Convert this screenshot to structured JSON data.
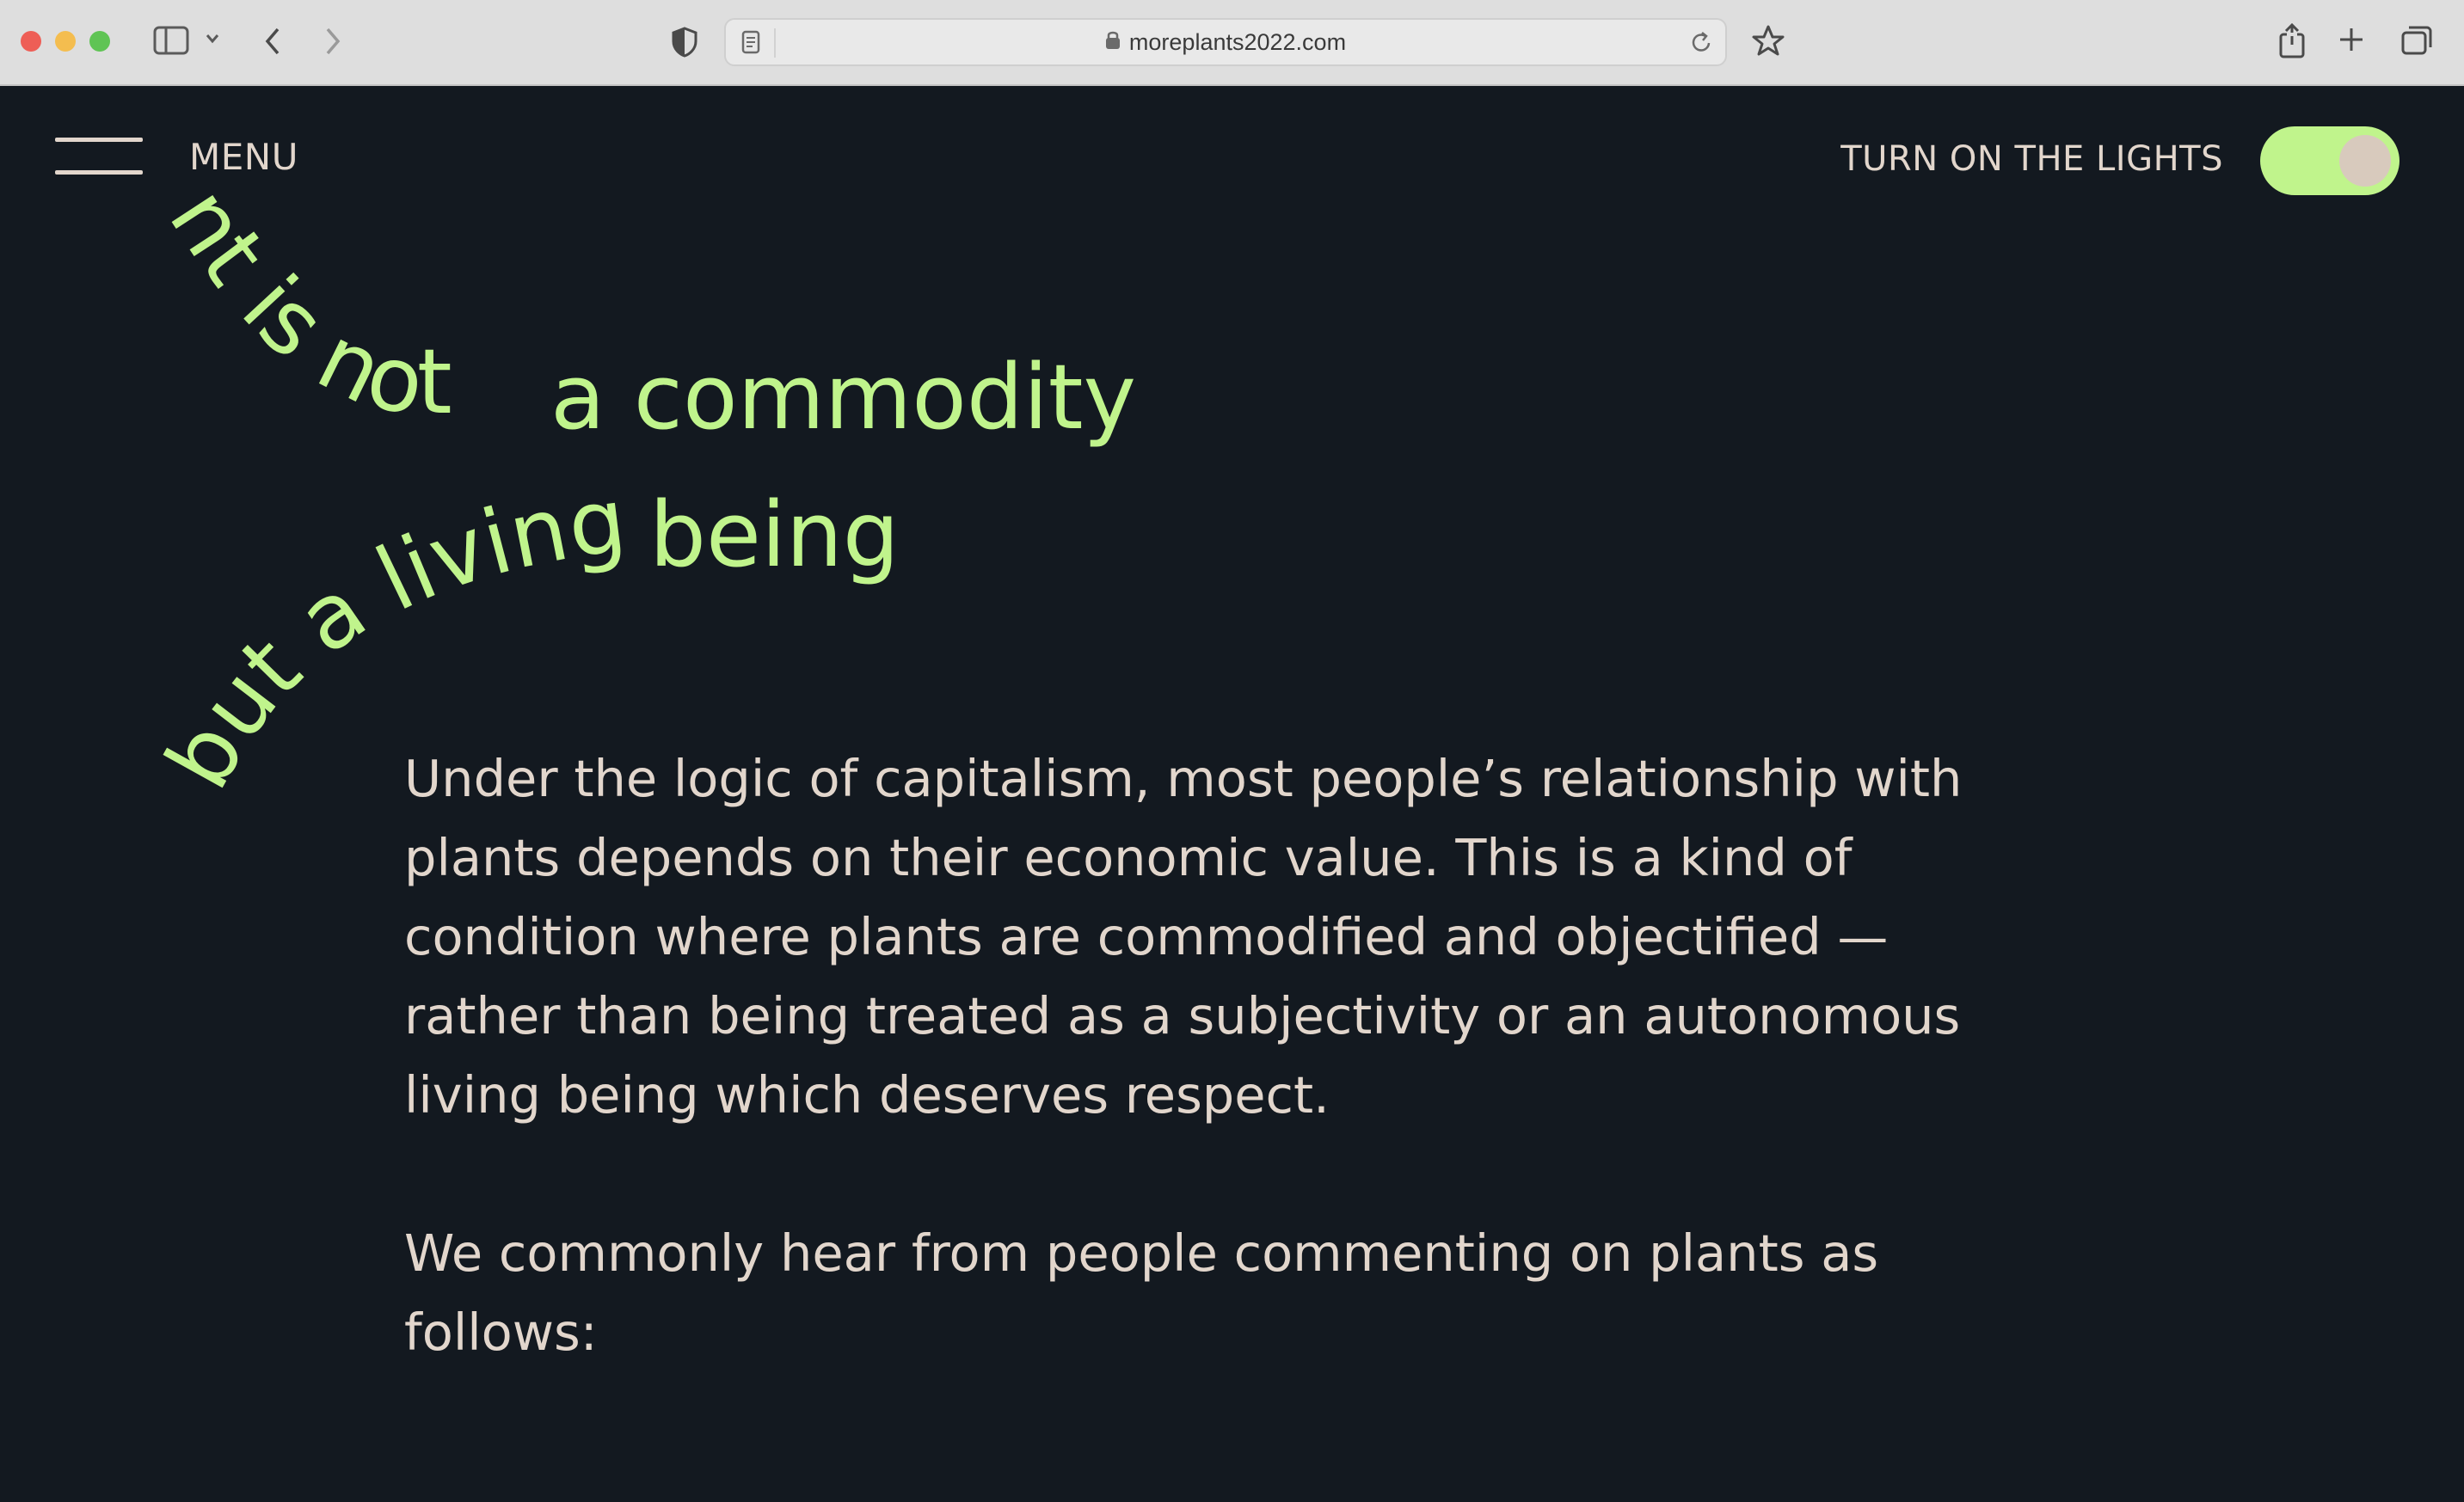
{
  "browser": {
    "url": "moreplants2022.com"
  },
  "header": {
    "menu_label": "MENU",
    "lights_label": "TURN ON THE LIGHTS",
    "toggle_on": true,
    "accent_color": "#c0f48c"
  },
  "heading": {
    "line1_curved": "nt is not",
    "line1_rest": "a commodity",
    "line2_curved": "but a living",
    "line2_rest": "being"
  },
  "content": {
    "paragraph1": "Under the logic of capitalism, most people’s relationship with plants depends on their economic value. This is a kind of condition where plants are commodified and objectified — rather than being treated as a subjectivity or an autonomous living being which deserves respect.",
    "paragraph2": "We commonly hear from people commenting on plants as follows:"
  }
}
